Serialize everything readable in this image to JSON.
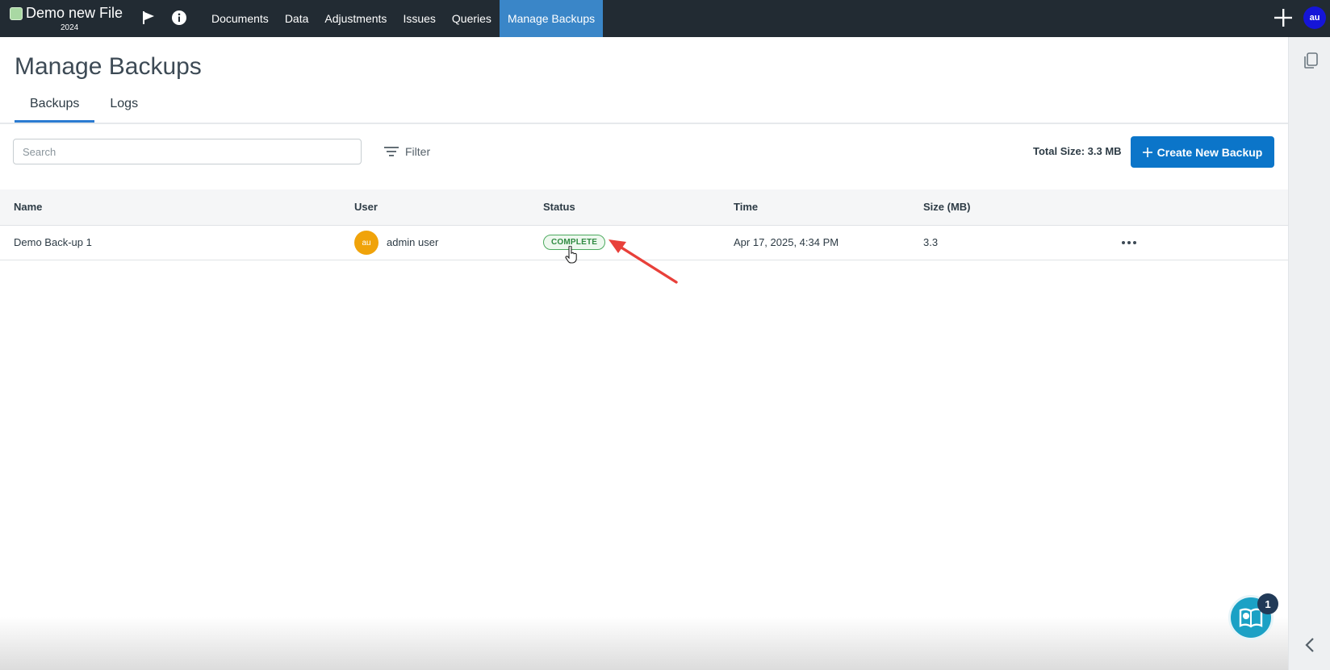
{
  "topbar": {
    "file_name": "Demo new File",
    "file_year": "2024",
    "nav_items": [
      "Documents",
      "Data",
      "Adjustments",
      "Issues",
      "Queries",
      "Manage Backups"
    ],
    "active_nav": "Manage Backups",
    "user_initials": "au"
  },
  "page": {
    "title": "Manage Backups",
    "tabs": [
      {
        "label": "Backups",
        "active": true
      },
      {
        "label": "Logs",
        "active": false
      }
    ]
  },
  "toolbar": {
    "search_placeholder": "Search",
    "filter_label": "Filter",
    "total_size": "Total Size: 3.3 MB",
    "create_label": "Create New Backup"
  },
  "table": {
    "headers": [
      "Name",
      "User",
      "Status",
      "Time",
      "Size (MB)"
    ],
    "rows": [
      {
        "name": "Demo Back-up 1",
        "user_initials": "au",
        "user": "admin user",
        "status": "COMPLETE",
        "time": "Apr 17, 2025, 4:34 PM",
        "size": "3.3"
      }
    ]
  },
  "help": {
    "badge_count": "1"
  },
  "colors": {
    "topbar": "#222b33",
    "active_nav": "#3a86c8",
    "primary_button": "#0b75c9",
    "status_complete": "#2f8a41",
    "user_avatar": "#f0a30a",
    "annotation_arrow": "#e8403a"
  }
}
